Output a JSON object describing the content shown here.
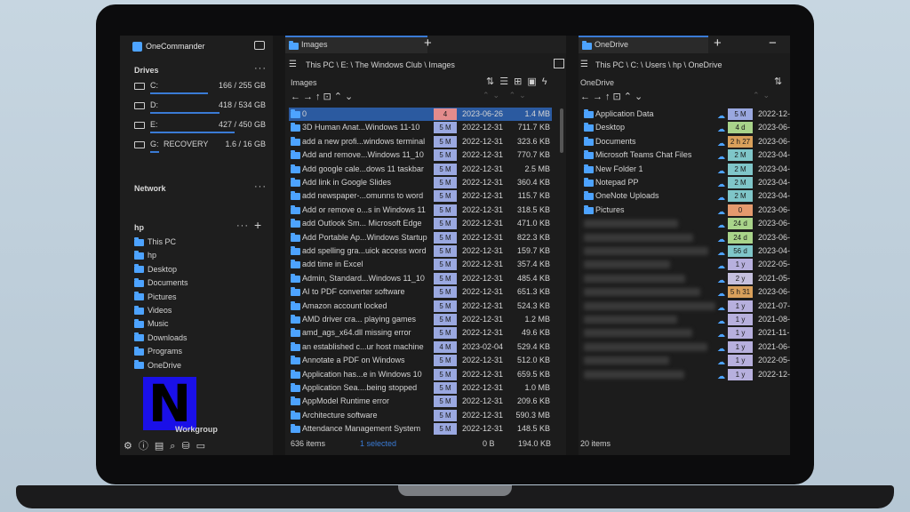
{
  "app": {
    "title": "OneCommander",
    "drives_title": "Drives",
    "network_title": "Network",
    "user_title": "hp",
    "workgroup_label": "Workgroup"
  },
  "drives": [
    {
      "letter": "C:",
      "label": "",
      "size": "166 / 255 GB",
      "fill": 0.65
    },
    {
      "letter": "D:",
      "label": "",
      "size": "418 / 534 GB",
      "fill": 0.78
    },
    {
      "letter": "E:",
      "label": "",
      "size": "427 / 450 GB",
      "fill": 0.95
    },
    {
      "letter": "G:",
      "label": "RECOVERY",
      "size": "1.6 / 16 GB",
      "fill": 0.1
    }
  ],
  "tree": [
    "This PC",
    "hp",
    "Desktop",
    "Documents",
    "Pictures",
    "Videos",
    "Music",
    "Downloads",
    "Programs",
    "OneDrive"
  ],
  "left_pane": {
    "tab": "Images",
    "path": "This PC \\ E: \\ The Windows Club \\ Images",
    "heading": "Images",
    "footer_count": "636 items",
    "footer_selected": "1 selected",
    "footer_total": "0 B",
    "footer_sel_size": "194.0 KB",
    "rows": [
      {
        "name": "0",
        "badge": "4",
        "badge_color": "#e48c8c",
        "date": "2023-06-26",
        "size": "1.4 MB",
        "selected": true
      },
      {
        "name": "3D Human Anat...Windows 11-10",
        "badge": "5 M",
        "badge_color": "#9aa8e0",
        "date": "2022-12-31",
        "size": "711.7 KB"
      },
      {
        "name": "add a new profi...windows terminal",
        "badge": "5 M",
        "badge_color": "#9aa8e0",
        "date": "2022-12-31",
        "size": "323.6 KB"
      },
      {
        "name": "Add and remove...Windows 11_10",
        "badge": "5 M",
        "badge_color": "#9aa8e0",
        "date": "2022-12-31",
        "size": "770.7 KB"
      },
      {
        "name": "Add google cale...dows 11 taskbar",
        "badge": "5 M",
        "badge_color": "#9aa8e0",
        "date": "2022-12-31",
        "size": "2.5 MB"
      },
      {
        "name": "Add link in Google Slides",
        "badge": "5 M",
        "badge_color": "#9aa8e0",
        "date": "2022-12-31",
        "size": "360.4 KB"
      },
      {
        "name": "add newspaper-...omunns to word",
        "badge": "5 M",
        "badge_color": "#9aa8e0",
        "date": "2022-12-31",
        "size": "115.7 KB"
      },
      {
        "name": "Add or remove o...s in Windows 11",
        "badge": "5 M",
        "badge_color": "#9aa8e0",
        "date": "2022-12-31",
        "size": "318.5 KB"
      },
      {
        "name": "add Outlook Sm... Microsoft Edge",
        "badge": "5 M",
        "badge_color": "#9aa8e0",
        "date": "2022-12-31",
        "size": "471.0 KB"
      },
      {
        "name": "Add Portable Ap...Windows Startup",
        "badge": "5 M",
        "badge_color": "#9aa8e0",
        "date": "2022-12-31",
        "size": "822.3 KB"
      },
      {
        "name": "add spelling gra...uick access word",
        "badge": "5 M",
        "badge_color": "#9aa8e0",
        "date": "2022-12-31",
        "size": "159.7 KB"
      },
      {
        "name": "add time in Excel",
        "badge": "5 M",
        "badge_color": "#9aa8e0",
        "date": "2022-12-31",
        "size": "357.4 KB"
      },
      {
        "name": "Admin, Standard...Windows 11_10",
        "badge": "5 M",
        "badge_color": "#9aa8e0",
        "date": "2022-12-31",
        "size": "485.4 KB"
      },
      {
        "name": "AI to PDF converter software",
        "badge": "5 M",
        "badge_color": "#9aa8e0",
        "date": "2022-12-31",
        "size": "651.3 KB"
      },
      {
        "name": "Amazon account locked",
        "badge": "5 M",
        "badge_color": "#9aa8e0",
        "date": "2022-12-31",
        "size": "524.3 KB"
      },
      {
        "name": "AMD driver cra... playing games",
        "badge": "5 M",
        "badge_color": "#9aa8e0",
        "date": "2022-12-31",
        "size": "1.2 MB"
      },
      {
        "name": "amd_ags_x64.dll missing error",
        "badge": "5 M",
        "badge_color": "#9aa8e0",
        "date": "2022-12-31",
        "size": "49.6 KB"
      },
      {
        "name": "an established c...ur host machine",
        "badge": "4 M",
        "badge_color": "#9aa8e0",
        "date": "2023-02-04",
        "size": "529.4 KB"
      },
      {
        "name": "Annotate a PDF on Windows",
        "badge": "5 M",
        "badge_color": "#9aa8e0",
        "date": "2022-12-31",
        "size": "512.0 KB"
      },
      {
        "name": "Application has...e in Windows 10",
        "badge": "5 M",
        "badge_color": "#9aa8e0",
        "date": "2022-12-31",
        "size": "659.5 KB"
      },
      {
        "name": "Application Sea....being stopped",
        "badge": "5 M",
        "badge_color": "#9aa8e0",
        "date": "2022-12-31",
        "size": "1.0 MB"
      },
      {
        "name": "AppModel Runtime error",
        "badge": "5 M",
        "badge_color": "#9aa8e0",
        "date": "2022-12-31",
        "size": "209.6 KB"
      },
      {
        "name": "Architecture software",
        "badge": "5 M",
        "badge_color": "#9aa8e0",
        "date": "2022-12-31",
        "size": "590.3 MB"
      },
      {
        "name": "Attendance Management System",
        "badge": "5 M",
        "badge_color": "#9aa8e0",
        "date": "2022-12-31",
        "size": "148.5 KB"
      }
    ]
  },
  "right_pane": {
    "tab": "OneDrive",
    "path": "This PC \\ C: \\ Users \\ hp \\ OneDrive",
    "heading": "OneDrive",
    "footer_count": "20 items",
    "rows": [
      {
        "name": "Application Data",
        "badge": "5 M",
        "badge_color": "#9aa8e0",
        "date": "2022-12-"
      },
      {
        "name": "Desktop",
        "badge": "4 d",
        "badge_color": "#a9d48a",
        "date": "2023-06-"
      },
      {
        "name": "Documents",
        "badge": "2 h 27",
        "badge_color": "#d9a05b",
        "date": "2023-06-"
      },
      {
        "name": "Microsoft Teams Chat Files",
        "badge": "2 M",
        "badge_color": "#7fc6c9",
        "date": "2023-04-"
      },
      {
        "name": "New Folder 1",
        "badge": "2 M",
        "badge_color": "#7fc6c9",
        "date": "2023-04-"
      },
      {
        "name": "Notepad PP",
        "badge": "2 M",
        "badge_color": "#7fc6c9",
        "date": "2023-04-"
      },
      {
        "name": "OneNote Uploads",
        "badge": "2 M",
        "badge_color": "#7fc6c9",
        "date": "2023-04-"
      },
      {
        "name": "Pictures",
        "badge": "0",
        "badge_color": "#e49a6e",
        "date": "2023-06-"
      },
      {
        "name": "",
        "badge": "24 d",
        "badge_color": "#a9d48a",
        "date": "2023-06-"
      },
      {
        "name": "",
        "badge": "24 d",
        "badge_color": "#a9d48a",
        "date": "2023-06-"
      },
      {
        "name": "",
        "badge": "56 d",
        "badge_color": "#7fc6c9",
        "date": "2023-04-"
      },
      {
        "name": "",
        "badge": "1 y",
        "badge_color": "#b7b0de",
        "date": "2022-05-"
      },
      {
        "name": "",
        "badge": "2 y",
        "badge_color": "#c5c0de",
        "date": "2021-05-"
      },
      {
        "name": "",
        "badge": "5 h 31",
        "badge_color": "#d9a05b",
        "date": "2023-06-"
      },
      {
        "name": "",
        "badge": "1 y",
        "badge_color": "#b7b0de",
        "date": "2021-07-"
      },
      {
        "name": "",
        "badge": "1 y",
        "badge_color": "#b7b0de",
        "date": "2021-08-"
      },
      {
        "name": "",
        "badge": "1 y",
        "badge_color": "#b7b0de",
        "date": "2021-11-"
      },
      {
        "name": "",
        "badge": "1 y",
        "badge_color": "#b7b0de",
        "date": "2021-06-"
      },
      {
        "name": "",
        "badge": "1 y",
        "badge_color": "#b7b0de",
        "date": "2022-05-"
      },
      {
        "name": "",
        "badge": "1 y",
        "badge_color": "#b7b0de",
        "date": "2022-12-"
      }
    ]
  },
  "icons": {
    "toolbar_left": [
      "sort-icon",
      "list-view-icon",
      "grid-view-icon",
      "clipboard-icon",
      "bolt-icon"
    ],
    "bottom": [
      "gear-icon",
      "info-icon",
      "terminal-icon",
      "search-icon",
      "database-icon",
      "chat-icon"
    ]
  }
}
